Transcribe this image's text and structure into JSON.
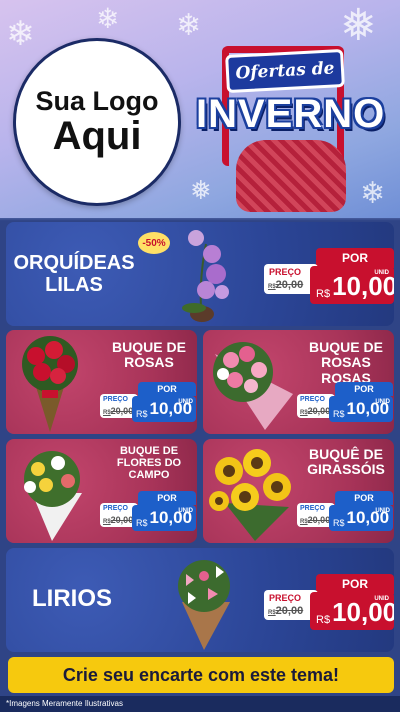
{
  "header": {
    "logo_line1": "Sua Logo",
    "logo_line2": "Aqui",
    "sign_text": "Ofertas de",
    "banner_text": "INVERNO"
  },
  "products": [
    {
      "title_line1": "ORQUÍDEAS",
      "title_line2": "LILAS",
      "badge": "-50%",
      "por": "POR",
      "preco": "PREÇO",
      "old_currency": "R$",
      "old_price": "20,00",
      "currency": "R$",
      "price": "10,00",
      "unid": "UNID"
    },
    {
      "title_line1": "BUQUE DE",
      "title_line2": "ROSAS",
      "por": "POR",
      "preco": "PREÇO",
      "old_currency": "R$",
      "old_price": "20,00",
      "currency": "R$",
      "price": "10,00",
      "unid": "UNID"
    },
    {
      "title_line1": "BUQUE DE",
      "title_line2": "ROSAS ROSAS",
      "por": "POR",
      "preco": "PREÇO",
      "old_currency": "R$",
      "old_price": "20,00",
      "currency": "R$",
      "price": "10,00",
      "unid": "UNID"
    },
    {
      "title_line1": "BUQUE DE",
      "title_line2": "FLORES DO",
      "title_line3": "CAMPO",
      "por": "POR",
      "preco": "PREÇO",
      "old_currency": "R$",
      "old_price": "20,00",
      "currency": "R$",
      "price": "10,00",
      "unid": "UNID"
    },
    {
      "title_line1": "BUQUÊ DE",
      "title_line2": "GIRASSÓIS",
      "por": "POR",
      "preco": "PREÇO",
      "old_currency": "R$",
      "old_price": "20,00",
      "currency": "R$",
      "price": "10,00",
      "unid": "UNID"
    },
    {
      "title_line1": "LIRIOS",
      "por": "POR",
      "preco": "PREÇO",
      "old_currency": "R$",
      "old_price": "20,00",
      "currency": "R$",
      "price": "10,00",
      "unid": "UNID"
    }
  ],
  "cta": "Crie seu encarte com este tema!",
  "footer": "*Imagens Meramente Ilustrativas",
  "colors": {
    "red": "#c8102e",
    "blue_tag": "#1d5fc9",
    "cta_yellow": "#f6c90e",
    "card_blue": "#2b4596",
    "card_pink": "#a83459"
  }
}
